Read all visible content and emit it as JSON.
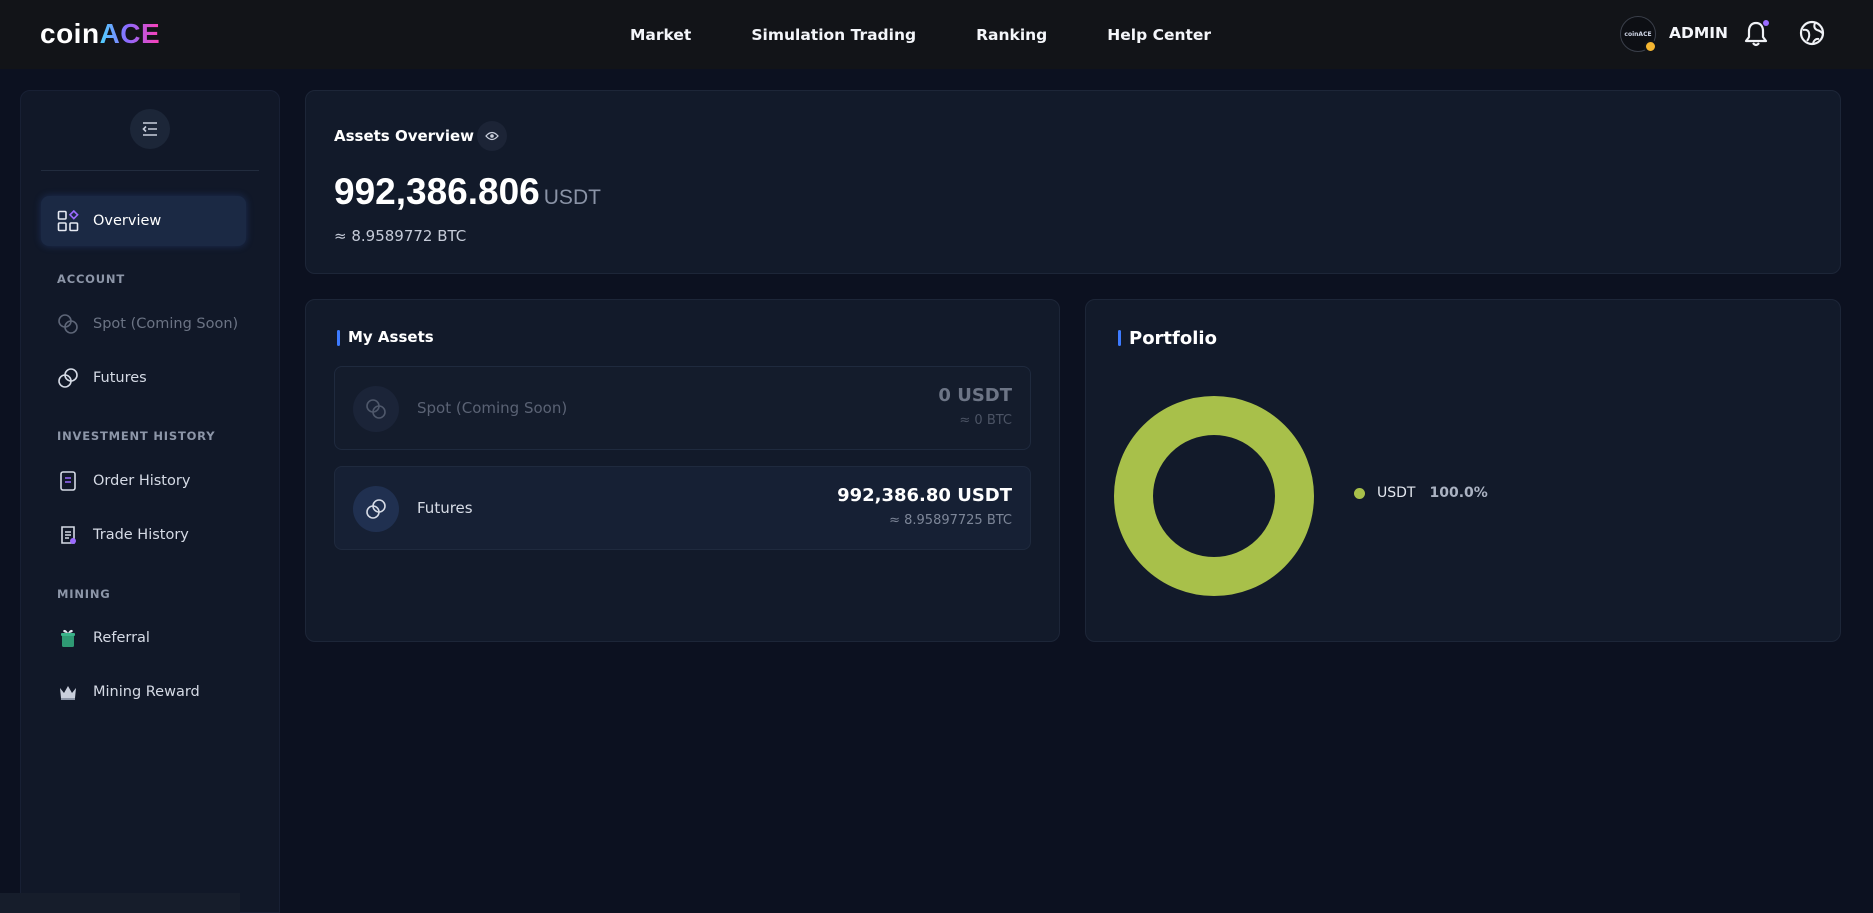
{
  "brand": {
    "name_part1": "coin",
    "name_part2": "ACE"
  },
  "nav": {
    "items": [
      "Market",
      "Simulation Trading",
      "Ranking",
      "Help Center"
    ]
  },
  "user": {
    "avatar_text": "coinACE",
    "name": "ADMIN"
  },
  "sidebar": {
    "overview": "Overview",
    "sections": [
      "ACCOUNT",
      "INVESTMENT HISTORY",
      "MINING"
    ],
    "account_items": [
      "Spot (Coming Soon)",
      "Futures"
    ],
    "history_items": [
      "Order History",
      "Trade History"
    ],
    "mining_items": [
      "Referral",
      "Mining Reward"
    ]
  },
  "overview": {
    "title": "Assets Overview",
    "balance": "992,386.806",
    "unit": "USDT",
    "btc": "≈ 8.9589772 BTC"
  },
  "my_assets": {
    "title": "My Assets",
    "rows": [
      {
        "name": "Spot (Coming Soon)",
        "value": "0 USDT",
        "btc": "≈ 0 BTC"
      },
      {
        "name": "Futures",
        "value": "992,386.80 USDT",
        "btc": "≈ 8.95897725 BTC"
      }
    ]
  },
  "portfolio": {
    "title": "Portfolio",
    "legend": [
      {
        "name": "USDT",
        "pct": "100.0%",
        "color": "#a8c04a"
      }
    ]
  },
  "chart_data": {
    "type": "pie",
    "categories": [
      "USDT"
    ],
    "values": [
      100.0
    ],
    "colors": [
      "#a8c04a"
    ],
    "title": "Portfolio",
    "donut": true,
    "legend_position": "right"
  }
}
